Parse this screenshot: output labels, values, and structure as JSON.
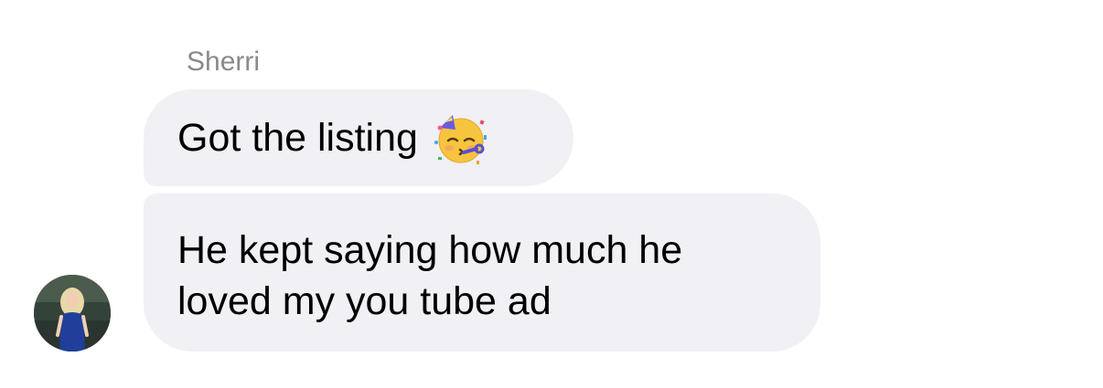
{
  "conversation": {
    "sender_name": "Sherri",
    "messages": [
      {
        "text": "Got the listing",
        "emoji": "partying-face-icon"
      },
      {
        "text": "He kept saying how much he\nloved my you tube ad"
      }
    ]
  },
  "colors": {
    "bubble_background": "#f0f0f5",
    "sender_name": "#8a8a8e",
    "message_text": "#000000"
  }
}
